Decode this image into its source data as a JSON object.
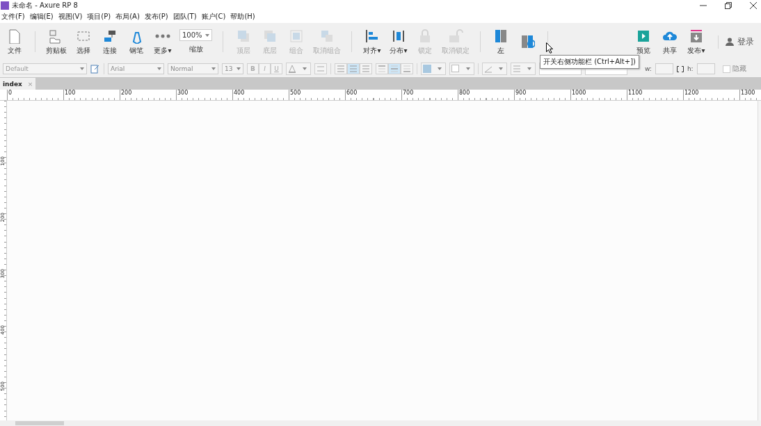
{
  "window": {
    "title": "未命名 - Axure RP 8"
  },
  "menu": [
    "文件(F)",
    "编辑(E)",
    "视图(V)",
    "项目(P)",
    "布局(A)",
    "发布(P)",
    "团队(T)",
    "账户(C)",
    "帮助(H)"
  ],
  "toolbar": [
    {
      "kind": "button",
      "label": "文件",
      "disabled": false
    },
    {
      "kind": "button",
      "label": "剪贴板",
      "disabled": false
    },
    {
      "kind": "button",
      "label": "选择",
      "disabled": false
    },
    {
      "kind": "button",
      "label": "连接",
      "disabled": false
    },
    {
      "kind": "button",
      "label": "钢笔",
      "disabled": false
    },
    {
      "kind": "button",
      "label": "更多▾",
      "disabled": false
    },
    {
      "kind": "zoom",
      "label": "缩放",
      "value": "100%"
    },
    {
      "kind": "button",
      "label": "顶层",
      "disabled": true
    },
    {
      "kind": "button",
      "label": "底层",
      "disabled": true
    },
    {
      "kind": "button",
      "label": "组合",
      "disabled": true
    },
    {
      "kind": "button",
      "label": "取消组合",
      "disabled": true
    },
    {
      "kind": "button",
      "label": "对齐▾",
      "disabled": false
    },
    {
      "kind": "button",
      "label": "分布▾",
      "disabled": false
    },
    {
      "kind": "button",
      "label": "锁定",
      "disabled": true
    },
    {
      "kind": "button",
      "label": "取消锁定",
      "disabled": true
    },
    {
      "kind": "button",
      "label": "左",
      "disabled": false
    },
    {
      "kind": "button",
      "disabled": false
    },
    {
      "kind": "spacer"
    },
    {
      "kind": "button",
      "label": "预览",
      "disabled": false
    },
    {
      "kind": "button",
      "label": "共享",
      "disabled": false
    },
    {
      "kind": "button",
      "label": "发布▾",
      "disabled": false
    },
    {
      "kind": "login",
      "label": "登录"
    }
  ],
  "format_bar": {
    "style": "Default",
    "font": "Arial",
    "weight": "Normal",
    "size": "13",
    "text_buttons": [
      {
        "label": "B",
        "selected": false
      },
      {
        "label": "I",
        "selected": false
      },
      {
        "label": "U",
        "selected": false
      }
    ],
    "h_align": [
      {
        "selected": false
      },
      {
        "selected": true
      },
      {
        "selected": false
      }
    ],
    "v_align": [
      {
        "selected": false
      },
      {
        "selected": true
      },
      {
        "selected": false
      }
    ],
    "w_label": "w:",
    "h_label": "h:",
    "hidden": {
      "label": "隐藏",
      "checked": false
    }
  },
  "tooltip": "开关右侧功能栏 (Ctrl+Alt+])",
  "tabs": [
    {
      "label": "index",
      "close": "×",
      "selected": true
    }
  ],
  "ruler": {
    "horizontal": [
      "0",
      "100",
      "200",
      "300",
      "400",
      "500",
      "600",
      "700",
      "800",
      "900",
      "1000",
      "1100",
      "1200",
      "1300"
    ],
    "vertical": [
      "100",
      "200",
      "300",
      "400",
      "500"
    ]
  }
}
